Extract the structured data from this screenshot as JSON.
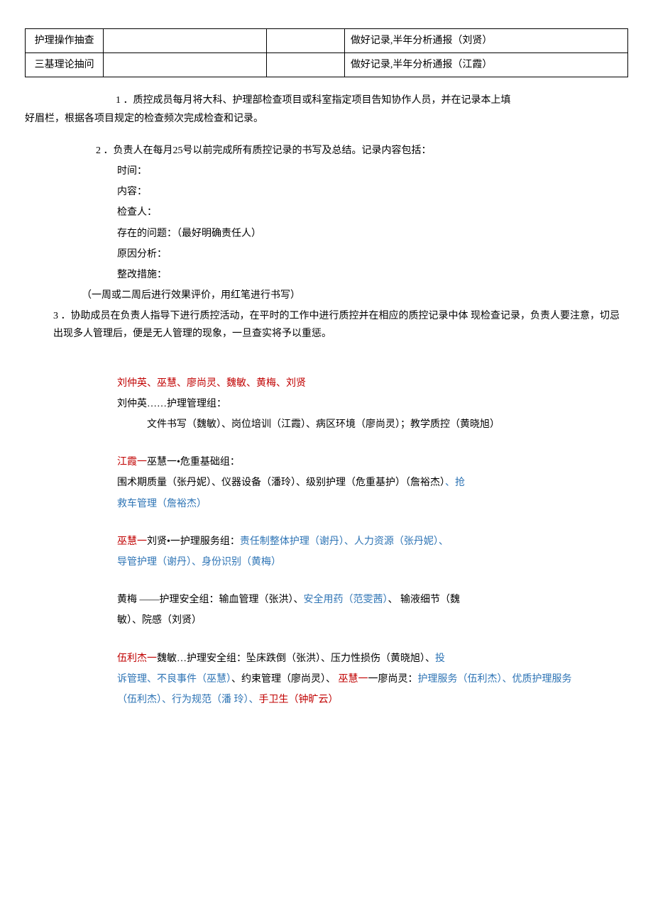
{
  "table": {
    "rows": [
      {
        "c1": "护理操作抽查",
        "c2": "",
        "c3": "",
        "c4": "做好记录,半年分析通报（刘贤）"
      },
      {
        "c1": "三基理论抽问",
        "c2": "",
        "c3": "",
        "c4": "做好记录,半年分析通报（江霞）"
      }
    ]
  },
  "paragraphs": {
    "p1a": "1 ．质控成员每月将大科、护理部检查项目或科室指定项目告知协作人员，并在记录本上填",
    "p1b": "好眉栏，根据各项目规定的检查频次完成检查和记录。",
    "p2": "2 ．负责人在每月25号以前完成所有质控记录的书写及总结。记录内容包括：",
    "list": {
      "time": "时间：",
      "content": "内容：",
      "inspector": "检查人：",
      "problem": "存在的问题：（最好明确责任人）",
      "reason": "原因分析：",
      "measure": " 整改措施："
    },
    "note": "（一周或二周后进行效果评价，用红笔进行书写）",
    "p3": "3 ．协助成员在负责人指导下进行质控活动，在平时的工作中进行质控并在相应的质控记录中体 现检查记录，负责人要注意，切忌出现多人管理后，便是无人管理的现象，一旦查实将予以重惩。"
  },
  "groups": {
    "g1_leaders": "刘仲英、巫慧、廖尚灵、魏敏、黄梅、刘贤",
    "g1_title": "刘仲英……护理管理组：",
    "g1_detail": "文件书写（魏敏）、岗位培训（江霞）、病区环境（廖尚灵）；教学质控（黄晓旭）",
    "g2_prefix_red": "江霞一",
    "g2_title_rest": "巫慧一•危重基础组：",
    "g2_detail_a": "围术期质量（张丹妮）、仪器设备（潘玲）、级别护理（危重基护）（詹裕杰）",
    "g2_detail_b_sep": "、",
    "g2_detail_b_blue": "抢",
    "g2_detail_c": "救车管理（詹裕杰）",
    "g3_prefix_red": "巫慧一",
    "g3_title_rest": "刘贤•一护理服务组：",
    "g3_detail_blue1": "责任制整体护理（谢丹）、人力资源（张丹妮）、",
    "g3_detail_line2": "导管护理（谢丹）、身份识别（黄梅）",
    "g4_title": "黄梅 ——护理安全组：",
    "g4_detail_a": "输血管理（张洪）、",
    "g4_detail_blue": "安全用药（范雯茜）",
    "g4_detail_b": "、 输液细节（魏",
    "g4_detail_c": "敏）、院感（刘贤）",
    "g5_prefix_red": "伍利杰一",
    "g5_title_rest": "魏敏…护理安全组：坠床跌倒（张洪）、压力性损伤（黄晓旭）、",
    "g5_blue1": "投",
    "g5_line2_blue": "诉管理、不良事件（巫慧）",
    "g5_line2_plain": "、约束管理（廖尚灵）、 ",
    "g5_line2_red": "巫慧一",
    "g5_line2_plain2": "一廖尚灵：",
    "g5_line2_blue2": "护理服务（伍利杰）、优质护理服务",
    "g5_line3_blue": "（伍利杰）、行为规范（潘 玲）、",
    "g5_line3_red": "手卫生（钟旷云）"
  }
}
